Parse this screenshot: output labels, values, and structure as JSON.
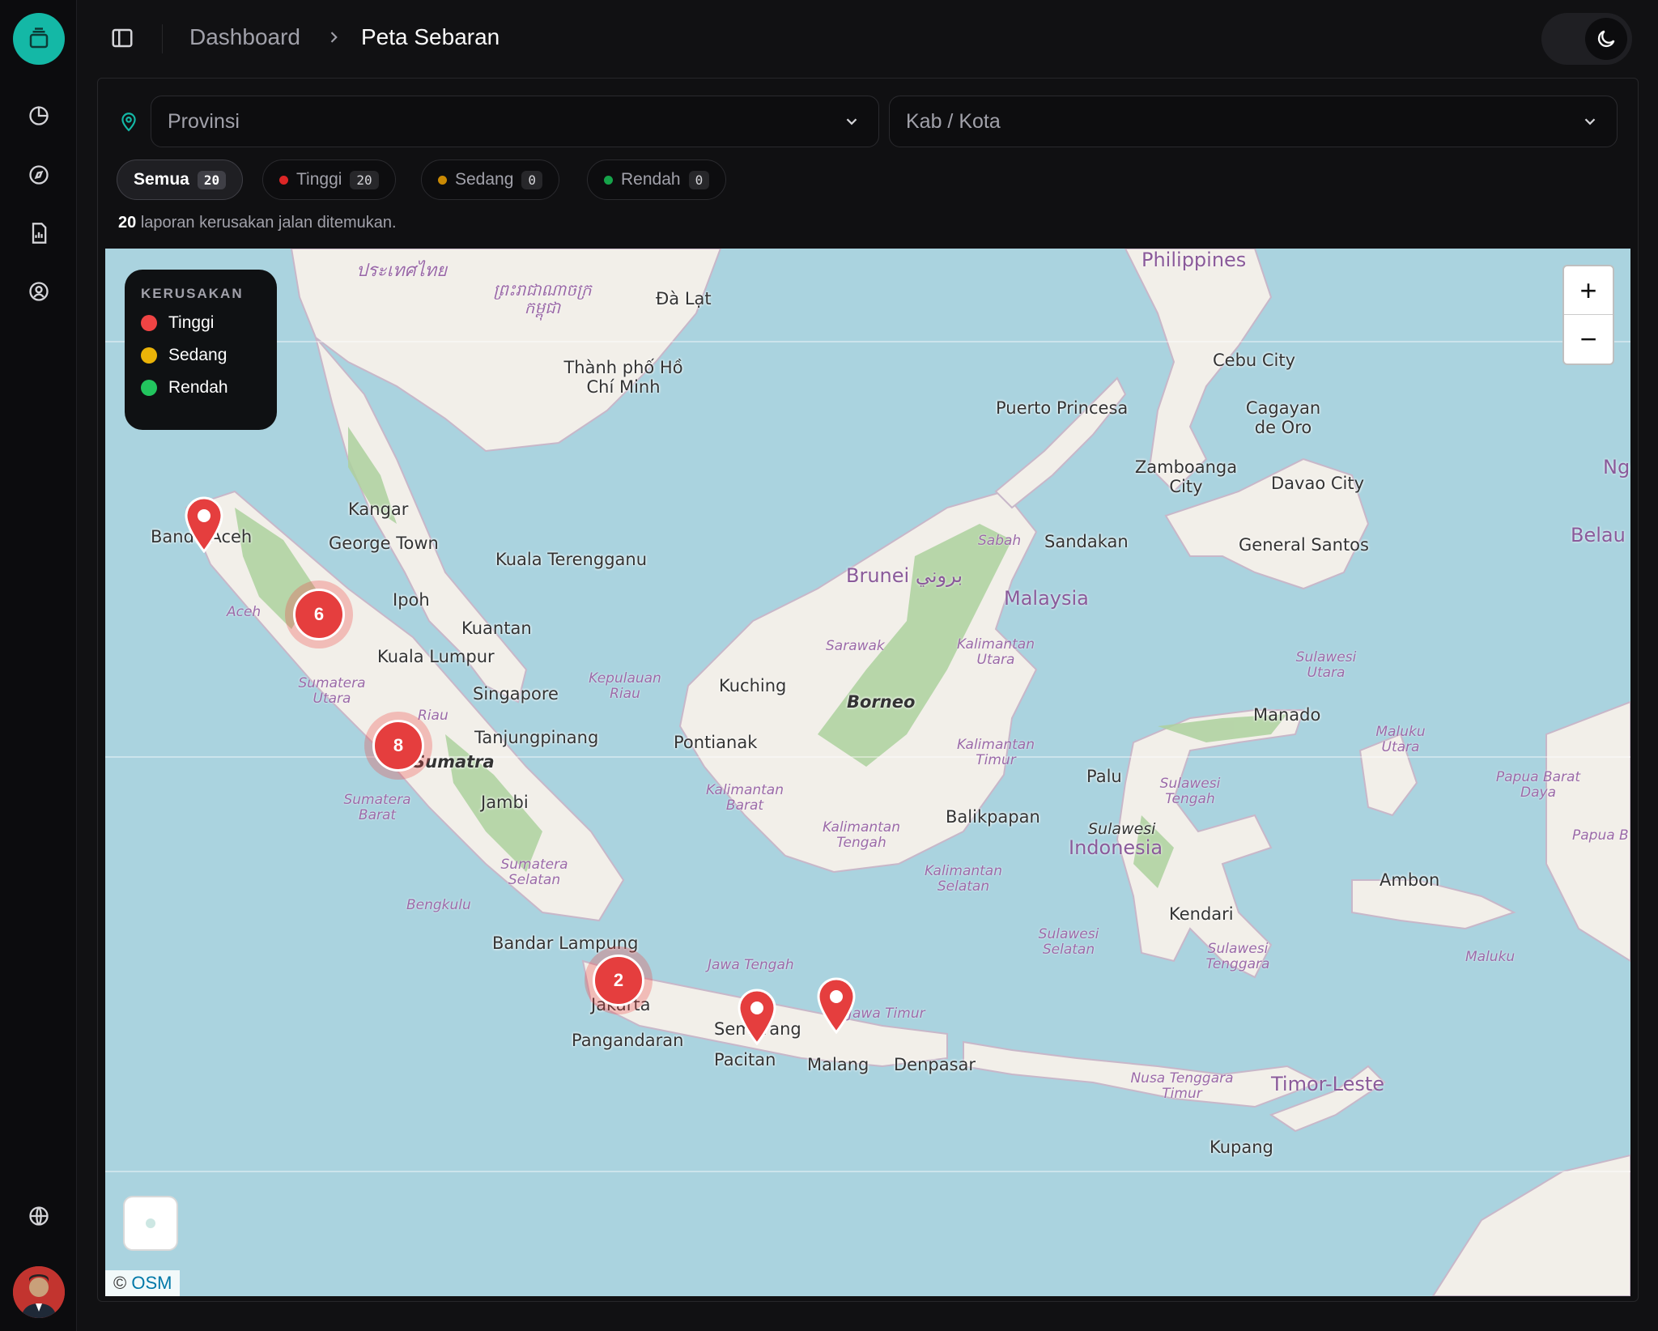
{
  "header": {
    "breadcrumb_root": "Dashboard",
    "breadcrumb_current": "Peta Sebaran"
  },
  "filters": {
    "province_placeholder": "Provinsi",
    "city_placeholder": "Kab / Kota"
  },
  "severity_tabs": [
    {
      "label": "Semua",
      "count": "20",
      "active": true
    },
    {
      "label": "Tinggi",
      "count": "20",
      "color": "#dc2626"
    },
    {
      "label": "Sedang",
      "count": "0",
      "color": "#ca8a04"
    },
    {
      "label": "Rendah",
      "count": "0",
      "color": "#16a34a"
    }
  ],
  "summary": {
    "count": "20",
    "text": "laporan kerusakan jalan ditemukan."
  },
  "legend": {
    "title": "KERUSAKAN",
    "items": [
      {
        "label": "Tinggi",
        "color": "#ef4444"
      },
      {
        "label": "Sedang",
        "color": "#eab308"
      },
      {
        "label": "Rendah",
        "color": "#22c55e"
      }
    ]
  },
  "map": {
    "zoom_in": "+",
    "zoom_out": "−",
    "attribution_prefix": "©",
    "attribution_link": "OSM",
    "clusters": [
      {
        "count": "6"
      },
      {
        "count": "8"
      },
      {
        "count": "2"
      }
    ],
    "single_markers": 3,
    "labels": {
      "philippines": "Philippines",
      "cebu": "Cebu City",
      "puerto_princesa": "Puerto Princesa",
      "cagayan": "Cagayan de Oro",
      "zamboanga": "Zamboanga City",
      "davao": "Davao City",
      "general_santos": "General Santos",
      "sandakan": "Sandakan",
      "sabah": "Sabah",
      "brunei": "Brunei بروني",
      "malaysia": "Malaysia",
      "kangar": "Kangar",
      "george_town": "George Town",
      "kuala_terengganu": "Kuala Terengganu",
      "ipoh": "Ipoh",
      "kuantan": "Kuantan",
      "kuala_lumpur": "Kuala Lumpur",
      "singapore": "Singapore",
      "tanjungpinang": "Tanjungpinang",
      "banda_aceh": "Banda Aceh",
      "aceh": "Aceh",
      "sumatera_utara": "Sumatera Utara",
      "riau": "Riau",
      "sumatra": "Sumatra",
      "sumatera_barat": "Sumatera Barat",
      "jambi": "Jambi",
      "sumatera_selatan": "Sumatera Selatan",
      "bengkulu": "Bengkulu",
      "bandar_lampung": "Bandar Lampung",
      "jakarta": "Jakarta",
      "pangandaran": "Pangandaran",
      "jawa_tengah": "Jawa Tengah",
      "semarang": "Semarang",
      "pacitan": "Pacitan",
      "jawa_timur": "Jawa Timur",
      "malang": "Malang",
      "denpasar": "Denpasar",
      "kuching": "Kuching",
      "pontianak": "Pontianak",
      "borneo": "Borneo",
      "sarawak": "Sarawak",
      "kalimantan_utara": "Kalimantan Utara",
      "kalimantan_timur": "Kalimantan Timur",
      "kalimantan_barat": "Kalimantan Barat",
      "kalimantan_tengah": "Kalimantan Tengah",
      "kalimantan_selatan": "Kalimantan Selatan",
      "balikpapan": "Balikpapan",
      "kepulauan_riau": "Kepulauan Riau",
      "palu": "Palu",
      "sulawesi": "Sulawesi",
      "indonesia": "Indonesia",
      "sulawesi_tengah": "Sulawesi Tengah",
      "sulawesi_utara": "Sulawesi Utara",
      "manado": "Manado",
      "maluku_utara": "Maluku Utara",
      "kendari": "Kendari",
      "sulawesi_selatan": "Sulawesi Selatan",
      "sulawesi_tenggara": "Sulawesi Tenggara",
      "ambon": "Ambon",
      "maluku": "Maluku",
      "papua_barat_daya": "Papua Barat Daya",
      "papua_b": "Papua B",
      "belau": "Belau",
      "nge": "Nge",
      "nusa_tenggara_timur": "Nusa Tenggara Timur",
      "timor_leste": "Timor-Leste",
      "kupang": "Kupang",
      "thailand": "ประเทศไทย",
      "cambodia": "ព្រះរាជាណាចក្រកម្ពុជា",
      "da_lat": "Đà Lạt",
      "hcmc": "Thành phố Hồ Chí Minh"
    }
  }
}
